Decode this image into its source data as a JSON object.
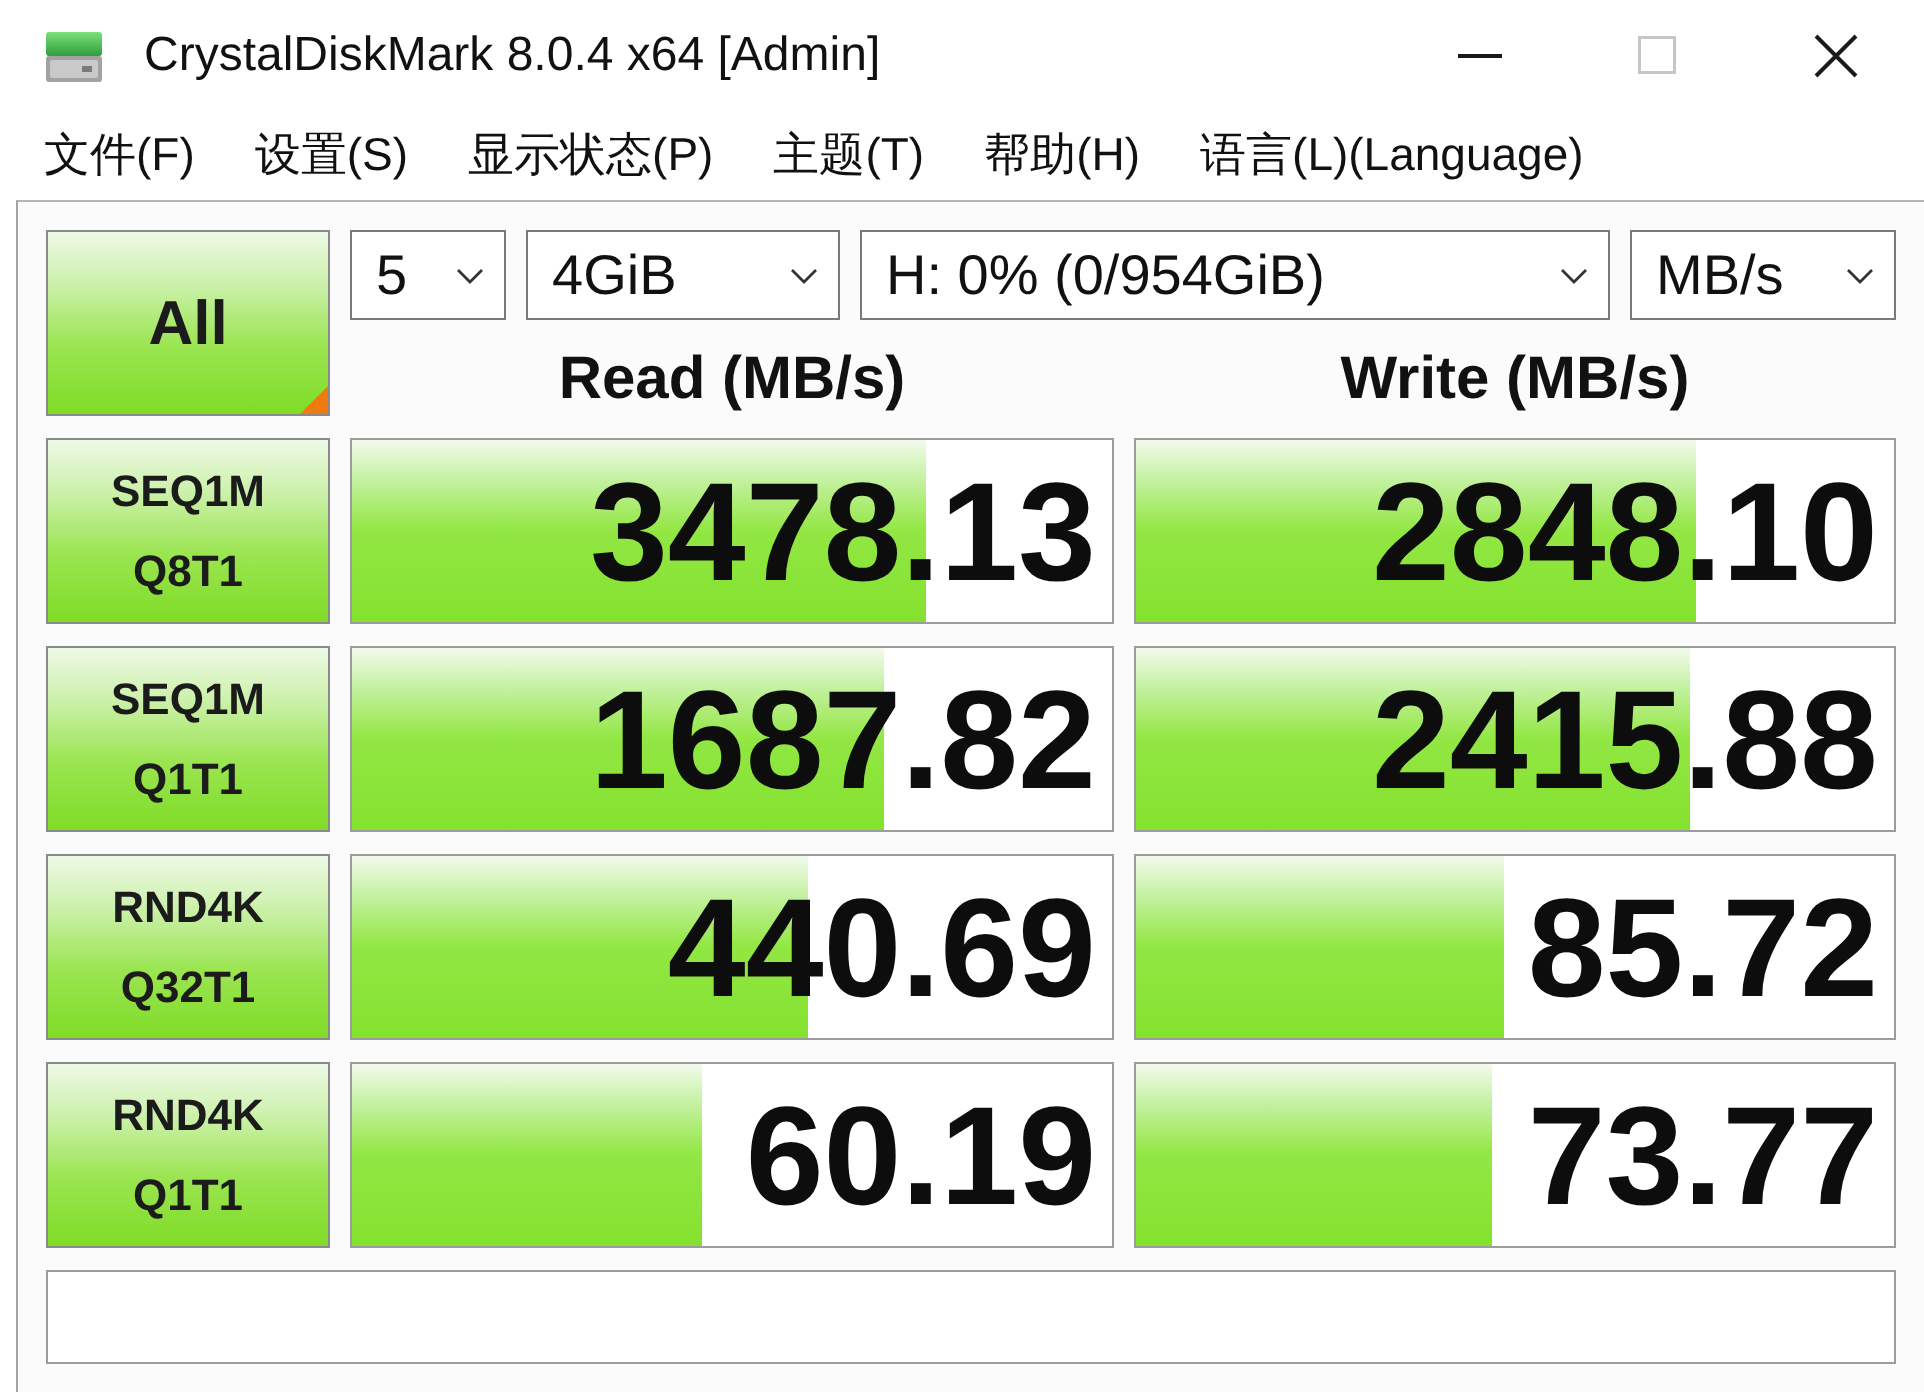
{
  "window": {
    "title": "CrystalDiskMark 8.0.4 x64 [Admin]",
    "buttons": [
      {
        "kind": "minimize",
        "disabled": false
      },
      {
        "kind": "maximize",
        "disabled": true
      },
      {
        "kind": "close",
        "disabled": false
      }
    ]
  },
  "menu": [
    "文件(F)",
    "设置(S)",
    "显示状态(P)",
    "主题(T)",
    "帮助(H)",
    "语言(L)(Language)"
  ],
  "toolbar": {
    "all_button": "All",
    "dropdowns": [
      {
        "value": "5"
      },
      {
        "value": "4GiB"
      },
      {
        "value": "H: 0% (0/954GiB)"
      },
      {
        "value": "MB/s"
      }
    ]
  },
  "columns": [
    "Read (MB/s)",
    "Write (MB/s)"
  ],
  "tests": [
    {
      "name": "SEQ1M",
      "params": "Q8T1",
      "read": {
        "value": "3478.13",
        "level": 0.754
      },
      "write": {
        "value": "2848.10",
        "level": 0.74
      }
    },
    {
      "name": "SEQ1M",
      "params": "Q1T1",
      "read": {
        "value": "1687.82",
        "level": 0.7
      },
      "write": {
        "value": "2415.88",
        "level": 0.73
      }
    },
    {
      "name": "RND4K",
      "params": "Q32T1",
      "read": {
        "value": "440.69",
        "level": 0.6
      },
      "write": {
        "value": "85.72",
        "level": 0.485
      }
    },
    {
      "name": "RND4K",
      "params": "Q1T1",
      "read": {
        "value": "60.19",
        "level": 0.46
      },
      "write": {
        "value": "73.77",
        "level": 0.47
      }
    }
  ]
}
